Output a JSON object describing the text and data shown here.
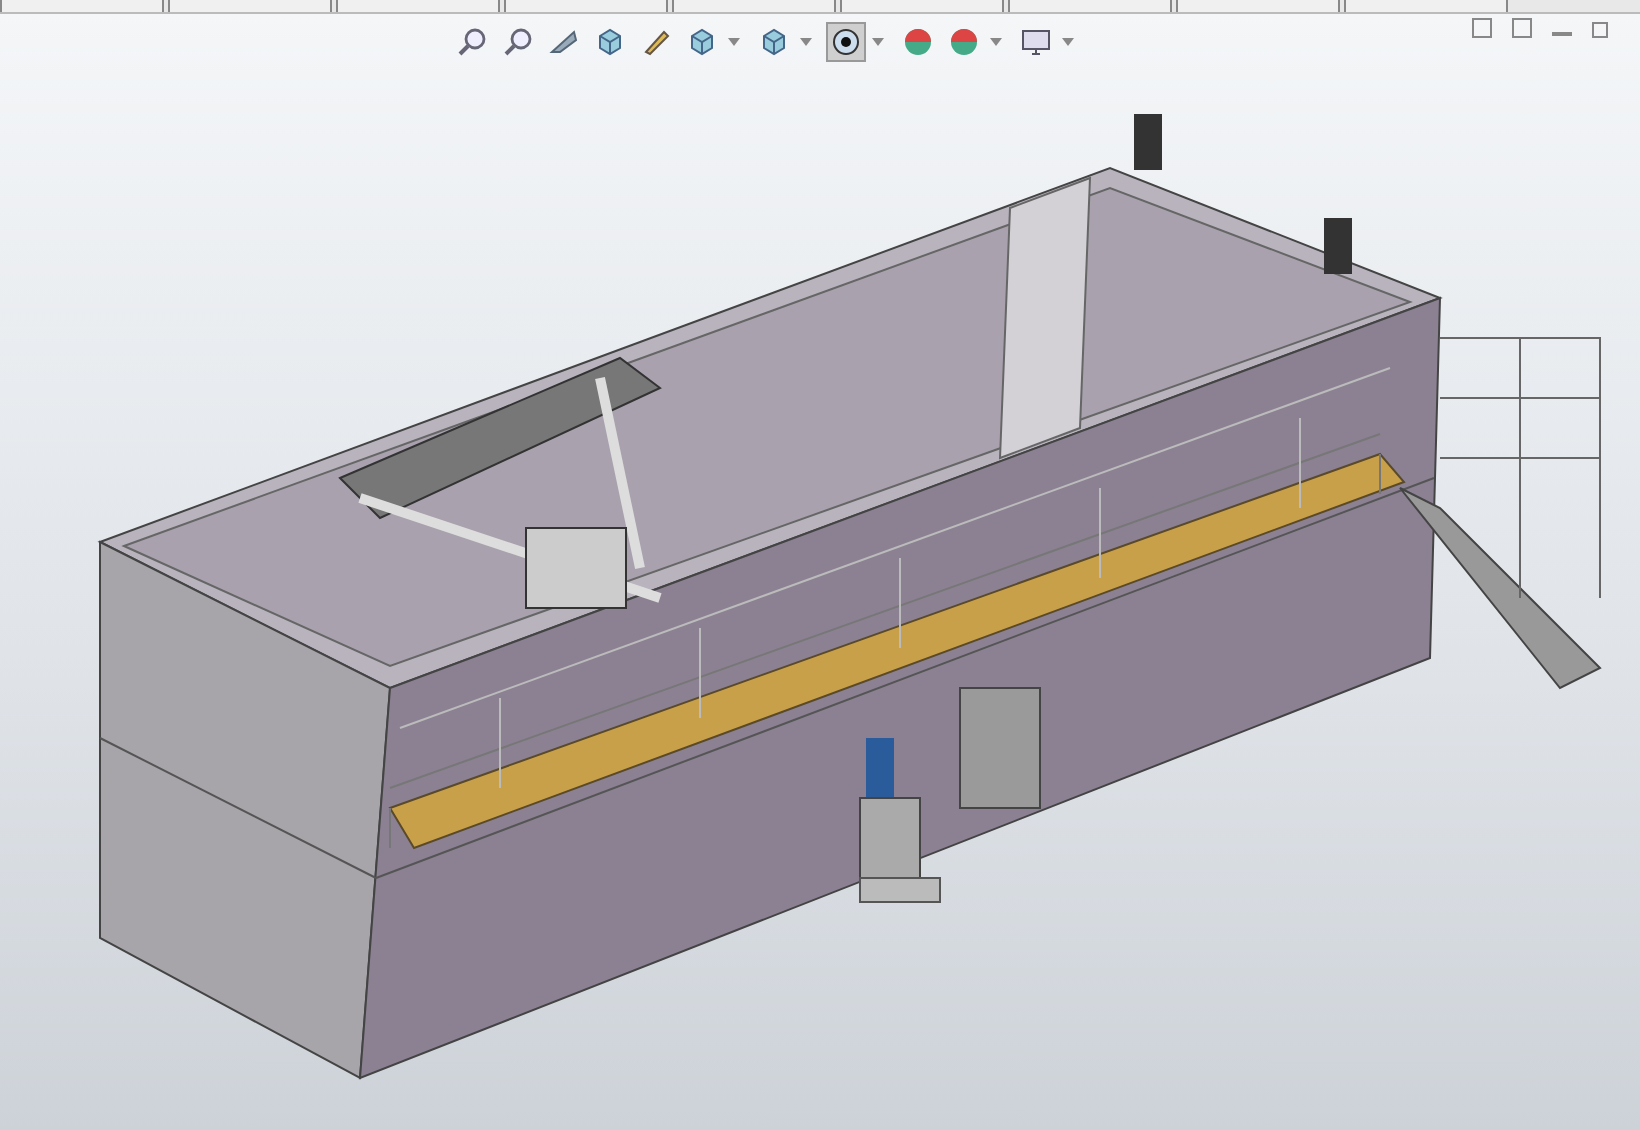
{
  "toolbar": {
    "tools": [
      {
        "kind": "zoom",
        "selected": false
      },
      {
        "kind": "zoom-area",
        "selected": false
      },
      {
        "kind": "previous-view",
        "selected": false
      },
      {
        "kind": "section",
        "selected": false
      },
      {
        "kind": "dynamic",
        "selected": false
      },
      {
        "kind": "orientation",
        "selected": false
      },
      {
        "kind": "display-style",
        "selected": false
      },
      {
        "kind": "hide-show",
        "selected": true
      },
      {
        "kind": "appearance",
        "selected": false
      },
      {
        "kind": "scene",
        "selected": false
      },
      {
        "kind": "display",
        "selected": false
      }
    ]
  }
}
